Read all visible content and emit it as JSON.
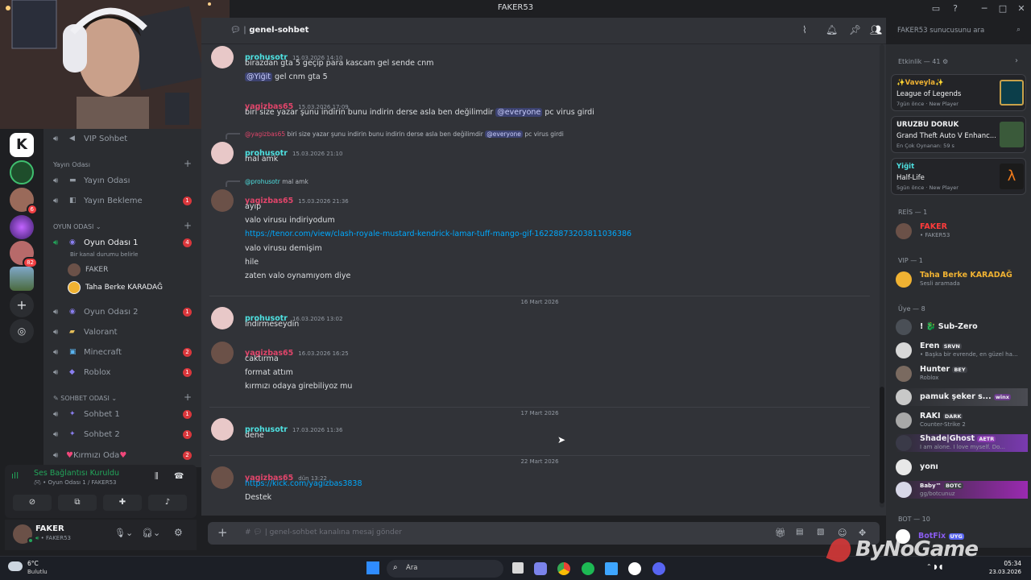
{
  "window": {
    "title": "FAKER53"
  },
  "channel": {
    "name": "genel-sohbet",
    "search_placeholder": "FAKER53 sunucusunu ara",
    "composer_placeholder": "genel-sohbet kanalına mesaj gönder"
  },
  "servers": [
    {
      "badge": "6"
    },
    {
      "badge": "82"
    }
  ],
  "channel_list": {
    "top_channel": "VIP Sohbet",
    "cat_stream": "Yayın Odası",
    "stream_channels": [
      {
        "name": "Yayın Odası",
        "badge": ""
      },
      {
        "name": "Yayın Bekleme",
        "badge": "1"
      }
    ],
    "cat_game": "OYUN ODASI",
    "game_room_1": {
      "name": "Oyun Odası 1",
      "badge": "4",
      "status": "Bir kanal durumu belirle"
    },
    "voice_users": [
      "FAKER",
      "Taha Berke KARADAĞ"
    ],
    "game_channels": [
      {
        "name": "Oyun Odası 2",
        "badge": "1"
      },
      {
        "name": "Valorant",
        "badge": ""
      },
      {
        "name": "Minecraft",
        "badge": "2"
      },
      {
        "name": "Roblox",
        "badge": "1"
      }
    ],
    "cat_chat": "SOHBET ODASI",
    "chat_channels": [
      {
        "name": "Sohbet 1",
        "badge": "1"
      },
      {
        "name": "Sohbet 2",
        "badge": "1"
      },
      {
        "name": "Kırmızı Oda",
        "badge": "2"
      }
    ]
  },
  "voice_status": {
    "title": "Ses Bağlantısı Kuruldu",
    "subtitle": "Oyun Odası 1 / FAKER53"
  },
  "user": {
    "name": "FAKER",
    "status": "FAKER53"
  },
  "messages": {
    "m1": {
      "user": "prohusotr",
      "ts": "15.03.2026 14:10",
      "lines": [
        "birazdan gta 5 geçip para kascam gel sende cnm"
      ],
      "mention": "@Yiğit",
      "mention_rest": " gel cnm gta 5"
    },
    "m2": {
      "user": "yagizbas65",
      "ts": "15.03.2026 17:09",
      "pre": "biri size yazar şunu indirin bunu indirin derse asla ben değilimdir",
      "mention": "@everyone",
      "post": "pc virus girdi"
    },
    "m3": {
      "reply_user": "@yagizbas65",
      "reply_pre": "biri size yazar şunu indirin bunu indirin derse asla ben değilimdir",
      "reply_mention": "@everyone",
      "reply_post": "pc virus girdi",
      "user": "prohusotr",
      "ts": "15.03.2026 21:10",
      "text": "mal amk"
    },
    "m4": {
      "reply_user": "@prohusotr",
      "reply_text": "mal amk",
      "user": "yagizbas65",
      "ts": "15.03.2026 21:36",
      "lines": [
        "ayıp",
        "valo virusu indiriyodum"
      ],
      "link": "https://tenor.com/view/clash-royale-mustard-kendrick-lamar-tuff-mango-gif-16228873203811036386",
      "lines2": [
        "valo virusu demişim",
        "hile",
        "zaten valo oynamıyom diye"
      ]
    },
    "d1": "16 Mart 2026",
    "m5": {
      "user": "prohusotr",
      "ts": "16.03.2026 13:02",
      "text": "indirmeseydin"
    },
    "m6": {
      "user": "yagizbas65",
      "ts": "16.03.2026 16:25",
      "lines": [
        "caktırma",
        "format attım",
        "kırmızı odaya girebiliyoz mu"
      ]
    },
    "d2": "17 Mart 2026",
    "m7": {
      "user": "prohusotr",
      "ts": "17.03.2026 11:36",
      "text": "dene"
    },
    "d3": "22 Mart 2026",
    "m8": {
      "user": "yagizbas65",
      "ts": "dün 13:22",
      "link": "https://kick.com/yagizbas3838",
      "text": "Destek"
    }
  },
  "members": {
    "activity_header": "Etkinlik — 41",
    "activities": [
      {
        "user": "Vaveyla",
        "game": "League of Legends",
        "meta": "7gün önce",
        "tag": "New Player"
      },
      {
        "user": "URUZBU DORUK",
        "game": "Grand Theft Auto V Enhanc...",
        "meta": "En Çok Oynanan: 59 s",
        "tag": ""
      },
      {
        "user": "Yiğit",
        "game": "Half-Life",
        "meta": "5gün önce",
        "tag": "New Player"
      }
    ],
    "reis_header": "REİS — 1",
    "reis": [
      {
        "name": "FAKER",
        "status": "• FAKER53"
      }
    ],
    "vip_header": "VIP — 1",
    "vip": [
      {
        "name": "Taha Berke KARADAĞ",
        "status": "Sesli aramada"
      }
    ],
    "uye_header": "Üye — 8",
    "uye": [
      {
        "name": "! 🐉 Sub-Zero",
        "tag": "",
        "status": ""
      },
      {
        "name": "Eren",
        "tag": "SRVN",
        "status": "• Başka bir evrende, en güzel ha..."
      },
      {
        "name": "Hunter",
        "tag": "BEY",
        "status": "Roblox"
      },
      {
        "name": "pamuk şeker s...",
        "tag": "winx",
        "status": ""
      },
      {
        "name": "RAKI",
        "tag": "DARK",
        "status": "Counter-Strike 2"
      },
      {
        "name": "Shade|Ghost",
        "tag": "AETR",
        "status": "I am alone. I love myself. Do..."
      },
      {
        "name": "yonı",
        "tag": "",
        "status": ""
      },
      {
        "name": "Baby™",
        "tag": "BOTC",
        "status": "gg/botcunuz"
      }
    ],
    "bot_header": "BOT — 10",
    "bot": [
      {
        "name": "BotFix",
        "tag": "UYG"
      }
    ]
  },
  "taskbar": {
    "weather_temp": "6°C",
    "weather_text": "Bulutlu",
    "search": "Ara",
    "time": "05:34",
    "date": "23.03.2026"
  },
  "watermark": "ByNoGame",
  "colors": {
    "accent": "#5865f2",
    "prohusotr": "#4ee1e1",
    "yagizbas65": "#e0456a",
    "faker": "#ff3b3b",
    "taha": "#f0b232",
    "online": "#23a55a",
    "dnd": "#f23f43"
  }
}
